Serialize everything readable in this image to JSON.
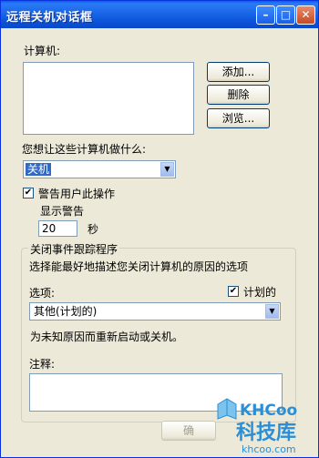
{
  "window": {
    "title": "远程关机对话框",
    "controls": {
      "minimize": "–",
      "maximize": "□",
      "close": "✕"
    }
  },
  "computers": {
    "label": "计算机:",
    "add_button": "添加...",
    "delete_button": "删除",
    "browse_button": "浏览..."
  },
  "action": {
    "prompt": "您想让这些计算机做什么:",
    "selected": "关机"
  },
  "warn": {
    "checkbox_label": "警告用户此操作",
    "checked": true,
    "display_label": "显示警告",
    "seconds_value": "20",
    "seconds_unit": "秒"
  },
  "tracker": {
    "group_title": "关闭事件跟踪程序",
    "description": "选择能最好地描述您关闭计算机的原因的选项",
    "option_label": "选项:",
    "planned_label": "计划的",
    "planned_checked": true,
    "selected_option": "其他(计划的)",
    "note": "为未知原因而重新启动或关机。",
    "comment_label": "注释:"
  },
  "footer": {
    "ok_button": "确"
  },
  "watermark": {
    "brand": "KHCoo",
    "name": "科技库",
    "url": "khcoo.com"
  },
  "colors": {
    "titlebar": "#0b53d8",
    "window_bg": "#ece9d8",
    "selection": "#316ac5",
    "watermark_blue": "#2a8fd6"
  }
}
